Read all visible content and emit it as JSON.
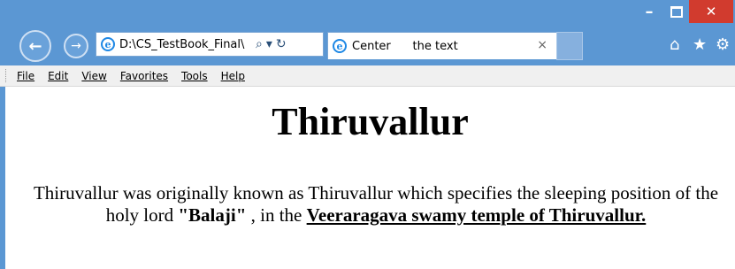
{
  "window": {
    "minimize_label": "–",
    "close_label": "✕"
  },
  "navigation": {
    "back_icon": "←",
    "forward_icon": "→",
    "address": "D:\\CS_TestBook_Final\\",
    "search_icon": "⌕",
    "dropdown_icon": "▾",
    "refresh_icon": "↻"
  },
  "tab": {
    "title": "Center      the text",
    "close_icon": "×"
  },
  "toolbar_icons": {
    "home": "⌂",
    "favorites": "★",
    "settings": "⚙"
  },
  "menu": {
    "items": [
      {
        "label": "File",
        "accel": "F",
        "rest": "ile"
      },
      {
        "label": "Edit",
        "accel": "E",
        "rest": "dit"
      },
      {
        "label": "View",
        "accel": "V",
        "rest": "iew"
      },
      {
        "label": "Favorites",
        "pre": "F",
        "accel": "a",
        "rest": "vorites"
      },
      {
        "label": "Tools",
        "accel": "T",
        "rest": "ools"
      },
      {
        "label": "Help",
        "accel": "H",
        "rest": "elp"
      }
    ]
  },
  "page": {
    "heading": "Thiruvallur",
    "para_text_1": "Thiruvallur was originally known as Thiruvallur which specifies the sleeping position of the holy lord ",
    "para_bold": "\"Balaji\"",
    "para_text_2": " , in the ",
    "para_link": "Veeraragava swamy temple of Thiruvallur."
  }
}
